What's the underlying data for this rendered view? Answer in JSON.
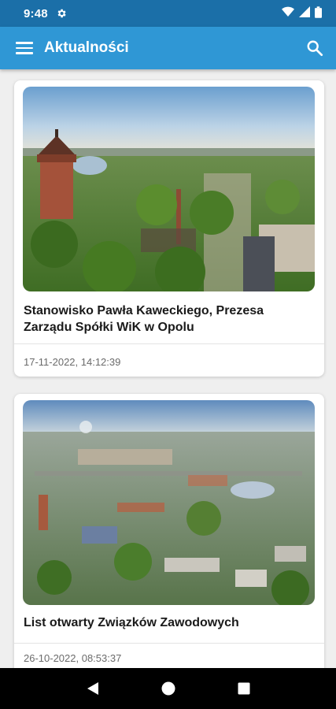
{
  "status_bar": {
    "time": "9:48",
    "icons": [
      "gear-icon",
      "wifi-icon",
      "signal-icon",
      "battery-icon"
    ]
  },
  "app_bar": {
    "title": "Aktualności",
    "menu_icon": "menu-icon",
    "search_icon": "search-icon",
    "color": "#2f97d5"
  },
  "news": [
    {
      "title": "Stanowisko Pawła Kaweckiego, Prezesa Zarządu Spółki WiK w Opolu",
      "date": "17-11-2022, 14:12:39",
      "image": "aerial-photo-water-tower"
    },
    {
      "title": "List otwarty Związków Zawodowych",
      "date": "26-10-2022, 08:53:37",
      "image": "aerial-photo-city"
    }
  ],
  "nav_bar": {
    "buttons": [
      "back-icon",
      "home-icon",
      "recents-icon"
    ]
  }
}
